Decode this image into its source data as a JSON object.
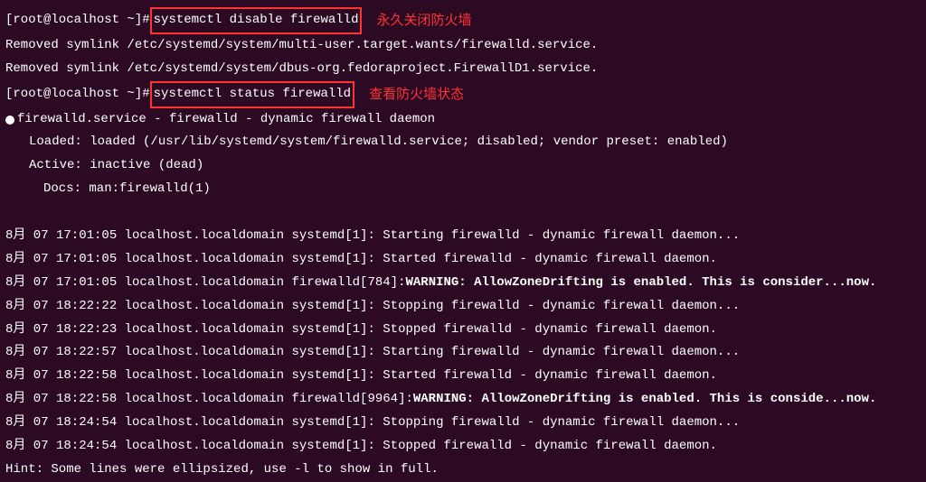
{
  "prompt": "[root@localhost ~]# ",
  "cmd1": "systemctl disable firewalld",
  "anno1": "永久关闭防火墙",
  "out1": "Removed symlink /etc/systemd/system/multi-user.target.wants/firewalld.service.",
  "out2": "Removed symlink /etc/systemd/system/dbus-org.fedoraproject.FirewallD1.service.",
  "cmd2": "systemctl status firewalld",
  "anno2": "查看防火墙状态",
  "status_header": "firewalld.service - firewalld - dynamic firewall daemon",
  "loaded": "Loaded: loaded (/usr/lib/systemd/system/firewalld.service; disabled; vendor preset: enabled)",
  "active": "Active: inactive (dead)",
  "docs": "Docs: man:firewalld(1)",
  "log": {
    "l1": "8月 07 17:01:05 localhost.localdomain systemd[1]: Starting firewalld - dynamic firewall daemon...",
    "l2": "8月 07 17:01:05 localhost.localdomain systemd[1]: Started firewalld - dynamic firewall daemon.",
    "l3p": "8月 07 17:01:05 localhost.localdomain firewalld[784]: ",
    "l3w": "WARNING: AllowZoneDrifting is enabled. This is consider...now.",
    "l4": "8月 07 18:22:22 localhost.localdomain systemd[1]: Stopping firewalld - dynamic firewall daemon...",
    "l5": "8月 07 18:22:23 localhost.localdomain systemd[1]: Stopped firewalld - dynamic firewall daemon.",
    "l6": "8月 07 18:22:57 localhost.localdomain systemd[1]: Starting firewalld - dynamic firewall daemon...",
    "l7": "8月 07 18:22:58 localhost.localdomain systemd[1]: Started firewalld - dynamic firewall daemon.",
    "l8p": "8月 07 18:22:58 localhost.localdomain firewalld[9964]: ",
    "l8w": "WARNING: AllowZoneDrifting is enabled. This is conside...now.",
    "l9": "8月 07 18:24:54 localhost.localdomain systemd[1]: Stopping firewalld - dynamic firewall daemon...",
    "l10": "8月 07 18:24:54 localhost.localdomain systemd[1]: Stopped firewalld - dynamic firewall daemon."
  },
  "hint": "Hint: Some lines were ellipsized, use -l to show in full."
}
